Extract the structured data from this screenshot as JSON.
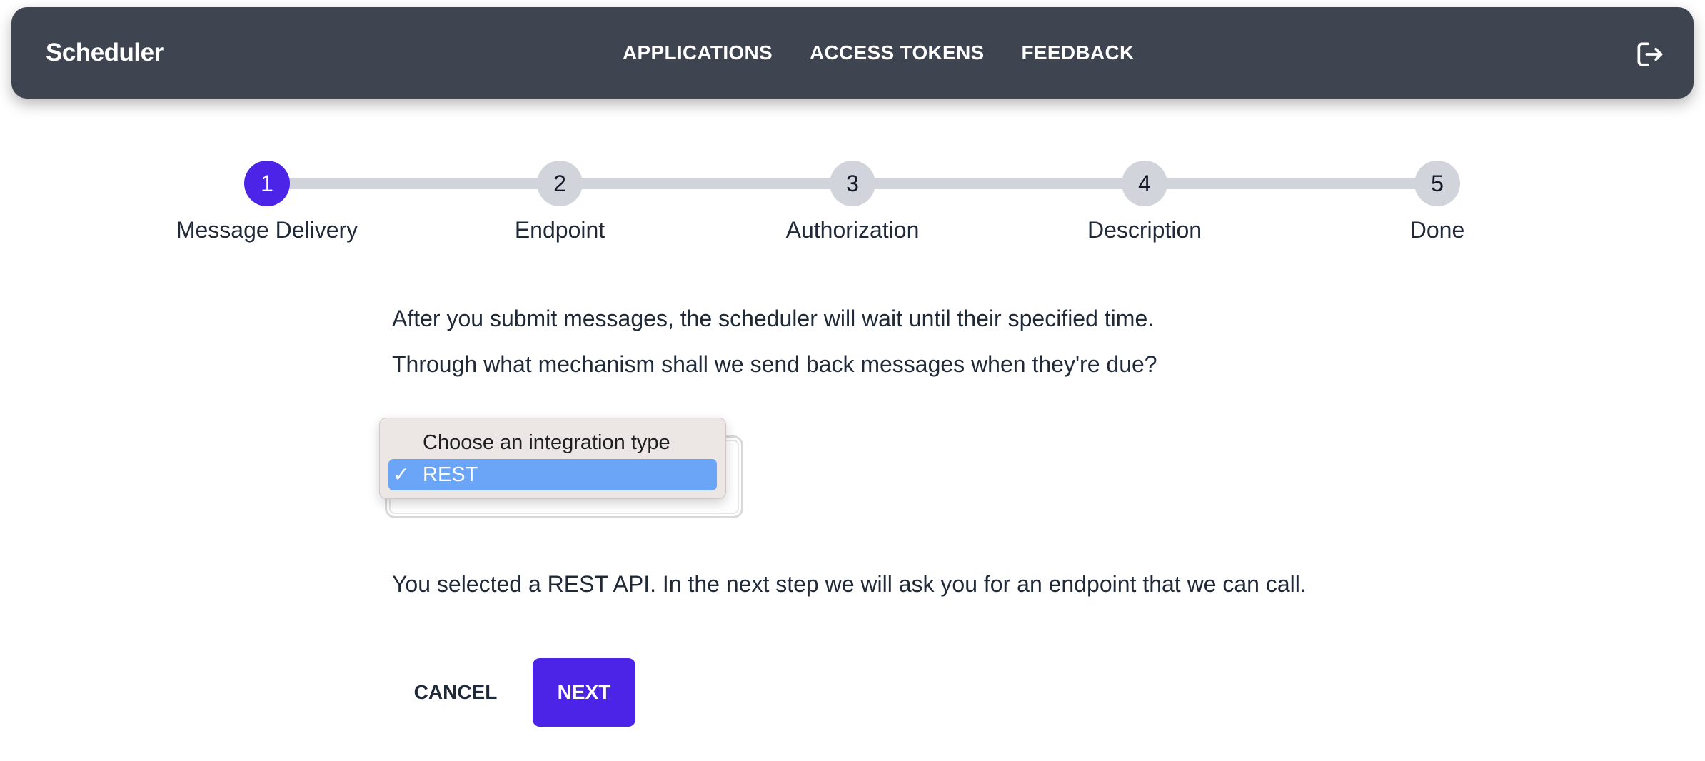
{
  "app": {
    "title": "Scheduler"
  },
  "nav": {
    "links": [
      "APPLICATIONS",
      "ACCESS TOKENS",
      "FEEDBACK"
    ],
    "logout_icon": "logout-icon"
  },
  "stepper": {
    "active_step": 1,
    "steps": [
      {
        "number": "1",
        "label": "Message Delivery"
      },
      {
        "number": "2",
        "label": "Endpoint"
      },
      {
        "number": "3",
        "label": "Authorization"
      },
      {
        "number": "4",
        "label": "Description"
      },
      {
        "number": "5",
        "label": "Done"
      }
    ]
  },
  "main": {
    "intro": "After you submit messages, the scheduler will wait until their specified time.",
    "question": "Through what mechanism shall we send back messages when they're due?",
    "integration_select": {
      "options": [
        "Choose an integration type",
        "REST"
      ],
      "selected": "REST",
      "check_mark": "✓"
    },
    "selection_note": "You selected a REST API. In the next step we will ask you for an endpoint that we can call."
  },
  "actions": {
    "cancel_label": "CANCEL",
    "next_label": "NEXT"
  },
  "colors": {
    "navbar_bg": "#3f4451",
    "accent": "#4c24e7",
    "step_inactive": "#d1d5db",
    "option_highlight": "#6aa5f8"
  }
}
